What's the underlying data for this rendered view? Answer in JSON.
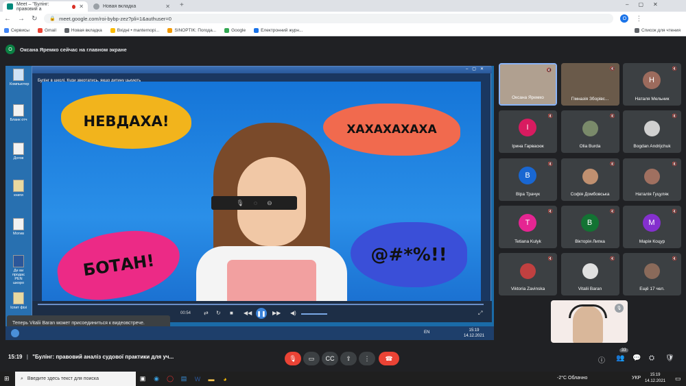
{
  "browser": {
    "tabs": [
      {
        "label": "Meet – \"Булінг: правовий а"
      },
      {
        "label": "Новая вкладка"
      }
    ],
    "url": "meet.google.com/roi-bybp-zez?pli=1&authuser=0",
    "profile_initial": "O",
    "bookmarks": [
      "Сервисы",
      "Gmail",
      "Новая вкладка",
      "Вхідні • manternopi...",
      "SINOPTIK: Погода...",
      "Google",
      "Електронний журн..."
    ],
    "reading_list": "Список для чтения"
  },
  "meet": {
    "presenter_initial": "О",
    "banner": "Оксана Яремко сейчас на главном экране",
    "shared_video": {
      "caption": "Булінг в школі. Куди звертатись, якщо дитину цькують_",
      "bubbles": [
        "НЕВДАХА!",
        "ХАХАХАХАХА",
        "БОТАН!",
        "@#*%!!"
      ],
      "time": "00:54",
      "clock_time": "15:19",
      "clock_date": "14.12.2021",
      "lang": "EN"
    },
    "desktop_icons": [
      "Компьютер",
      "Бланк отч",
      "Догов",
      "книги",
      "Мотив",
      "Де ви продає PEN шкоро",
      "Іспит фізі"
    ],
    "notification": "Теперь Vitalii Baran может присоединиться к видеовстрече.",
    "participants": [
      {
        "name": "Оксана Яремко",
        "initial": "",
        "color": "#b0a090",
        "photo": true
      },
      {
        "name": "Гімназія Зборівс...",
        "initial": "",
        "color": "#6a5a4a",
        "photo": true
      },
      {
        "name": "Наталя Мельник",
        "initial": "Н",
        "color": "#9c6b5d"
      },
      {
        "name": "Ірина Гарвасюк",
        "initial": "І",
        "color": "#d81b60"
      },
      {
        "name": "Olia Burda",
        "initial": "",
        "color": "#7a8a6a",
        "photo": true
      },
      {
        "name": "Bogdan Andrijchuk",
        "initial": "",
        "color": "#d0d0d0",
        "photo": true
      },
      {
        "name": "Віра Трачук",
        "initial": "В",
        "color": "#1967d2"
      },
      {
        "name": "Софія Домбовська",
        "initial": "",
        "color": "#c09070",
        "photo": true
      },
      {
        "name": "Наталія Гуцуляк",
        "initial": "",
        "color": "#a07060",
        "photo": true
      },
      {
        "name": "Tetiana Kulyk",
        "initial": "T",
        "color": "#e52592"
      },
      {
        "name": "Вікторія Липка",
        "initial": "В",
        "color": "#137333"
      },
      {
        "name": "Марія Коцур",
        "initial": "M",
        "color": "#8430ce"
      },
      {
        "name": "Viktoria Zavinska",
        "initial": "",
        "color": "#c04040",
        "photo": true
      },
      {
        "name": "Vitalii Baran",
        "initial": "",
        "color": "#e0e0e0",
        "photo": true
      },
      {
        "name": "Ещё 17 чел.",
        "initial": "",
        "color": "#8a6a5a",
        "photo": true
      }
    ],
    "meeting_time": "15:19",
    "meeting_title": "\"Булінг: правовий аналіз судової практики для уч...",
    "people_count": "33"
  },
  "taskbar": {
    "search_placeholder": "Введите здесь текст для поиска",
    "weather": "-2°C Облачно",
    "lang": "УКР",
    "time": "15:19",
    "date": "14.12.2021"
  }
}
